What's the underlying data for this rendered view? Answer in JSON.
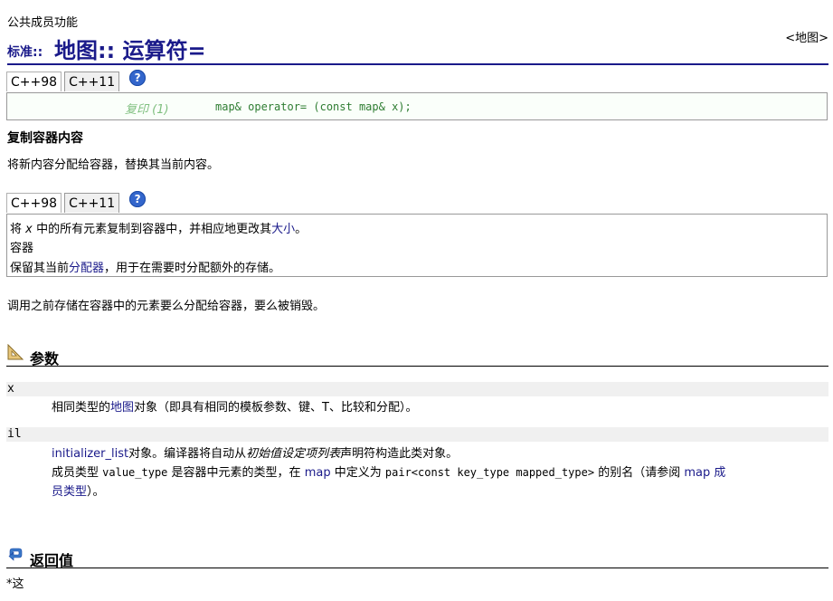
{
  "header": {
    "member_type": "公共成员功能",
    "namespace": "标准::",
    "title": "地图:: 运算符=",
    "back_link": "<地图>"
  },
  "tabs": {
    "cpp98": "C++98",
    "cpp11": "C++11",
    "help": "?"
  },
  "signature": {
    "label": "复印 (1)",
    "code": "map& operator= (const map& x);"
  },
  "summary": {
    "heading": "复制容器内容",
    "text": "将新内容分配给容器，替换其当前内容。"
  },
  "detail_box": {
    "line1_a": "将",
    "line1_x": "x",
    "line1_b": "中的所有元素复制到容器中，并相应地更改其",
    "line1_link": "大小",
    "line1_c": "。",
    "line2": "容器",
    "line3_a": "保留其当前",
    "line3_link": "分配器",
    "line3_b": "，用于在需要时分配额外的存储。"
  },
  "destroy_note": "调用之前存储在容器中的元素要么分配给容器，要么被销毁。",
  "parameters": {
    "title": "参数",
    "items": [
      {
        "name": "x",
        "desc_a": "相同类型的",
        "desc_link": "地图",
        "desc_b": "对象（即具有相同的模板参数、键、T、比较和分配）。"
      },
      {
        "name": "il",
        "desc1_link": "initializer_list",
        "desc1_a": "对象。编译器将自动从",
        "desc1_em": "初始值设定项列表",
        "desc1_b": "声明符构造此类对象。",
        "desc2_a": "成员类型",
        "desc2_code1": "value_type",
        "desc2_b": "是容器中元素的类型，在",
        "desc2_link1": "map",
        "desc2_c": "中定义为",
        "desc2_code2": "pair<const key_type mapped_type>",
        "desc2_d": "的别名（请参阅",
        "desc2_link2": "map 成",
        "desc3_link": "员类型",
        "desc3_end": "）。"
      }
    ]
  },
  "return_value": {
    "title": "返回值",
    "text": "*这"
  },
  "colors": {
    "heading_blue": "#1a1a8a",
    "code_green": "#2e7d32",
    "param_bg": "#f0f0f0"
  }
}
